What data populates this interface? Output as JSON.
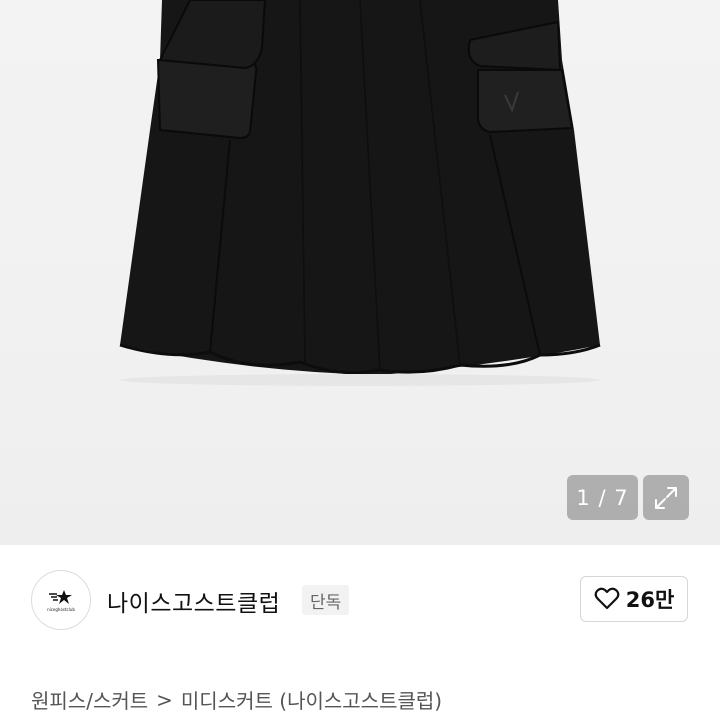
{
  "gallery": {
    "counter": "1 / 7",
    "expand_icon": "expand-arrows-icon"
  },
  "brand": {
    "logo_text": "niceghostclub",
    "name": "나이스고스트클럽",
    "badge": "단독"
  },
  "like": {
    "icon": "heart-outline-icon",
    "count": "26만"
  },
  "category": {
    "primary": "원피스/스커트",
    "separator": ">",
    "secondary": "미디스커트 (나이스고스트클럽)"
  }
}
